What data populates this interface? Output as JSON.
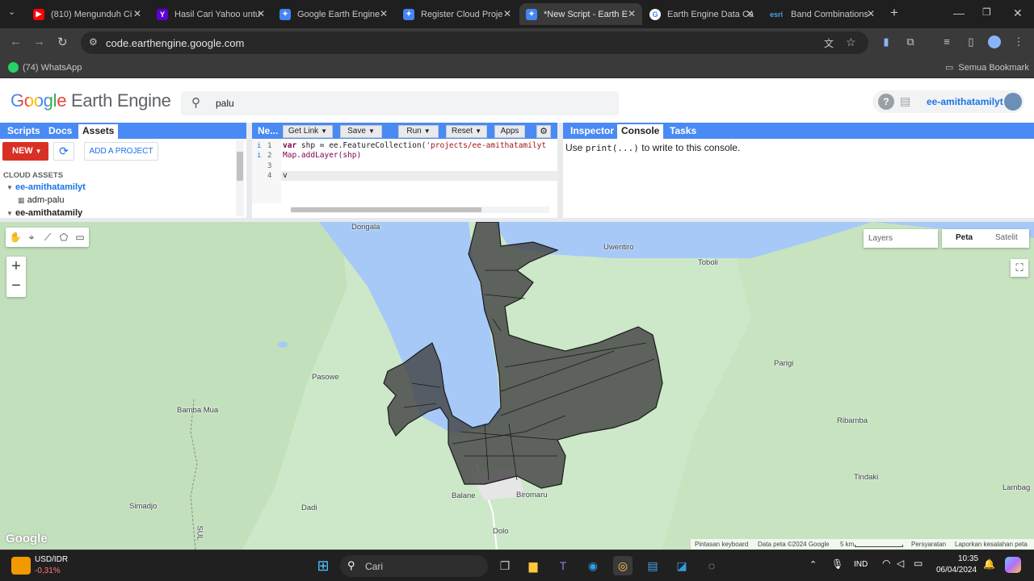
{
  "browser": {
    "tabs": [
      {
        "title": "(810) Mengunduh Ci",
        "icon": "youtube-icon",
        "color": "#ff0000"
      },
      {
        "title": "Hasil Cari Yahoo untu",
        "icon": "yahoo-icon",
        "color": "#6001d2"
      },
      {
        "title": "Google Earth Engine",
        "icon": "earth-engine-icon",
        "color": "#4285f4"
      },
      {
        "title": "Register Cloud Proje",
        "icon": "earth-engine-icon",
        "color": "#4285f4"
      },
      {
        "title": "*New Script - Earth E",
        "icon": "earth-engine-icon",
        "color": "#4285f4"
      },
      {
        "title": "Earth Engine Data Ca",
        "icon": "google-icon",
        "color": "#ffffff"
      },
      {
        "title": "Band Combinations",
        "icon": "esri-icon",
        "color": "#1f1f1f"
      }
    ],
    "url": "code.earthengine.google.com",
    "bookmarks": {
      "whatsapp": "(74) WhatsApp",
      "all": "Semua Bookmark"
    }
  },
  "gee": {
    "logo_google": "Google",
    "logo_product": "Earth Engine",
    "search_value": "palu",
    "user": "ee-amithatamilyt",
    "left_tabs": [
      "Scripts",
      "Docs",
      "Assets"
    ],
    "new_button": "NEW",
    "add_project": "ADD A PROJECT",
    "cloud_assets": "CLOUD ASSETS",
    "tree": [
      "ee-amithatamilyt",
      "adm-palu",
      "ee-amithatamily"
    ],
    "code_toolbar": {
      "tab": "Ne...",
      "get_link": "Get Link",
      "save": "Save",
      "run": "Run",
      "reset": "Reset",
      "apps": "Apps"
    },
    "code_lines": [
      {
        "num": "1",
        "text_kw": "var",
        "text_rest": " shp = ee.FeatureCollection(",
        "text_str": "'projects/ee-amithatamilyt"
      },
      {
        "num": "2",
        "text": "Map.addLayer(shp)"
      },
      {
        "num": "3",
        "text": ""
      },
      {
        "num": "4",
        "text": "v"
      }
    ],
    "right_tabs": [
      "Inspector",
      "Console",
      "Tasks"
    ],
    "console_hint_pre": "Use ",
    "console_hint_code": "print(...)",
    "console_hint_post": " to write to this console."
  },
  "map": {
    "layers_label": "Layers",
    "map_types": [
      "Peta",
      "Satelit"
    ],
    "zoom_in": "+",
    "zoom_out": "−",
    "places": [
      "Dongala",
      "Uwentiro",
      "Toboli",
      "Pasowe",
      "Parigi",
      "Bamba Mua",
      "Ribamba",
      "Tindaki",
      "Lambag",
      "Balane",
      "Biromaru",
      "Simadjo",
      "Dadi",
      "Dolo",
      "SUL"
    ],
    "attribution": [
      "Pintasan keyboard",
      "Data peta ©2024 Google",
      "5 km",
      "Persyaratan",
      "Laporkan kesalahan peta"
    ],
    "google_watermark": "Google"
  },
  "taskbar": {
    "widget_title": "USD/IDR",
    "widget_value": "-0,31%",
    "search": "Cari",
    "lang": "IND",
    "time": "10:35",
    "date": "06/04/2024"
  }
}
